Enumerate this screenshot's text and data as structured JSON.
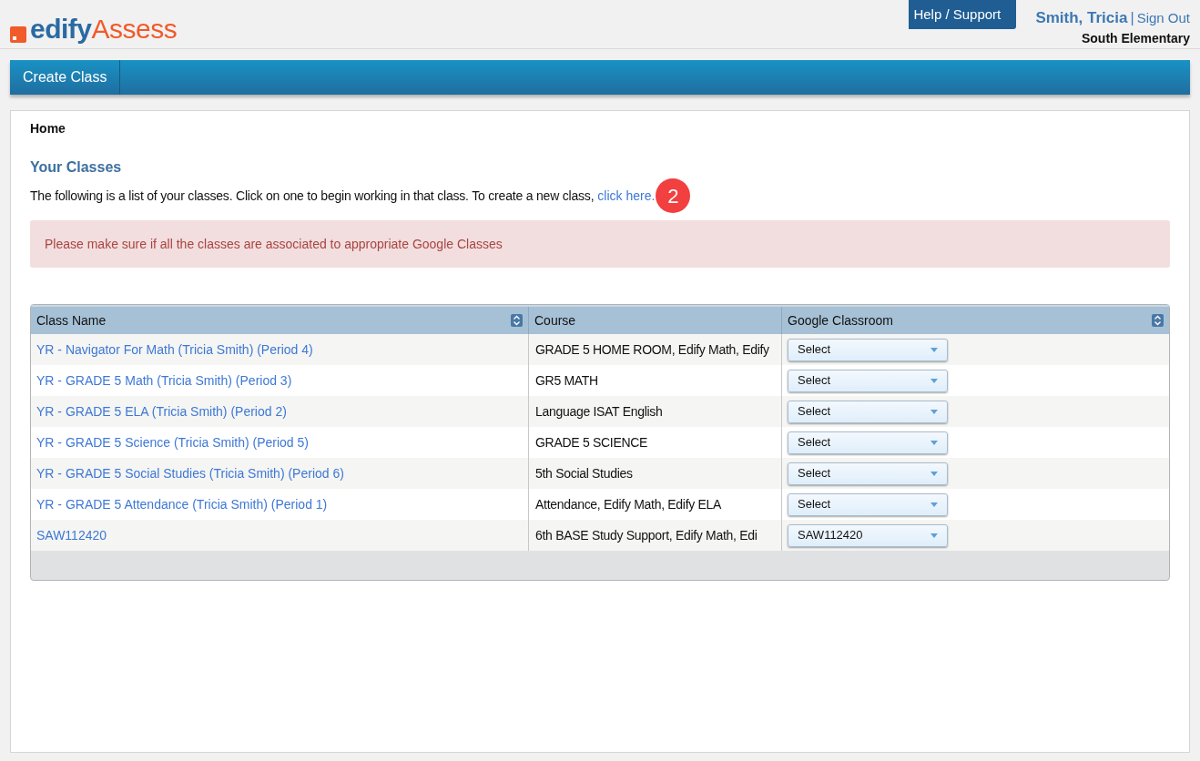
{
  "logo": {
    "brand": "edify",
    "product": "Assess"
  },
  "header": {
    "help": "Help / Support",
    "user": "Smith, Tricia",
    "separator": "|",
    "sign_out": "Sign Out",
    "school": "South Elementary"
  },
  "nav": {
    "items": [
      {
        "label": "Create Class"
      }
    ]
  },
  "breadcrumb": "Home",
  "section_title": "Your Classes",
  "intro": {
    "text": "The following is a list of your classes. Click on one to begin working in that class. To create a new class,",
    "link": "click here.",
    "step_badge": "2"
  },
  "alert": "Please make sure if all the classes are associated to appropriate Google Classes",
  "table": {
    "columns": [
      {
        "label": "Class Name",
        "sortable": true
      },
      {
        "label": "Course",
        "sortable": false
      },
      {
        "label": "Google Classroom",
        "sortable": true
      }
    ],
    "rows": [
      {
        "class_name": "YR - Navigator For Math (Tricia Smith) (Period 4)",
        "course": "GRADE 5 HOME ROOM, Edify Math, Edify",
        "google_classroom": "Select"
      },
      {
        "class_name": "YR - GRADE 5 Math (Tricia Smith) (Period 3)",
        "course": "GR5 MATH",
        "google_classroom": "Select"
      },
      {
        "class_name": "YR - GRADE 5 ELA (Tricia Smith) (Period 2)",
        "course": "Language ISAT English",
        "google_classroom": "Select"
      },
      {
        "class_name": "YR - GRADE 5 Science (Tricia Smith) (Period 5)",
        "course": "GRADE 5 SCIENCE",
        "google_classroom": "Select"
      },
      {
        "class_name": "YR - GRADE 5 Social Studies (Tricia Smith) (Period 6)",
        "course": "5th Social Studies",
        "google_classroom": "Select"
      },
      {
        "class_name": "YR - GRADE 5 Attendance (Tricia Smith) (Period 1)",
        "course": "Attendance, Edify Math, Edify ELA",
        "google_classroom": "Select"
      },
      {
        "class_name": "SAW112420",
        "course": "6th BASE Study Support, Edify Math, Edi",
        "google_classroom": "SAW112420"
      }
    ]
  }
}
